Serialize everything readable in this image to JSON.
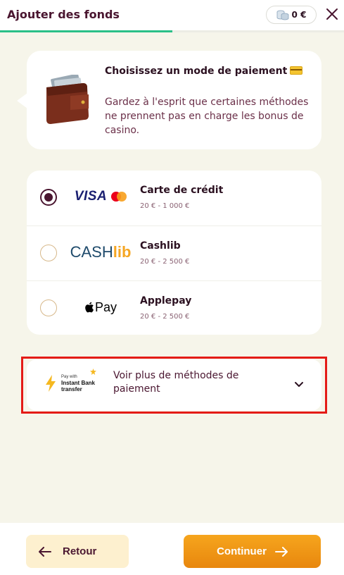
{
  "header": {
    "title": "Ajouter des fonds",
    "balance": "0 €",
    "progress_percent": 50
  },
  "info": {
    "title": "Choisissez un mode de paiement",
    "text": "Gardez à l'esprit que certaines méthodes ne prennent pas en charge les bonus de casino."
  },
  "methods": [
    {
      "name": "Carte de crédit",
      "range": "20 € - 1 000 €",
      "logo": "visa-mastercard-logo",
      "logo_text": "VISA",
      "selected": true
    },
    {
      "name": "Cashlib",
      "range": "20 € - 2 500 €",
      "logo": "cashlib-logo",
      "logo_text_a": "CASH",
      "logo_text_b": "lib",
      "selected": false
    },
    {
      "name": "Applepay",
      "range": "20 € - 2 500 €",
      "logo": "applepay-logo",
      "logo_text": "Pay",
      "selected": false
    }
  ],
  "more": {
    "label": "Voir plus de méthodes de paiement",
    "badge_small": "Pay with",
    "badge_strong": "Instant Bank transfer"
  },
  "footer": {
    "back_label": "Retour",
    "continue_label": "Continuer"
  },
  "colors": {
    "primary": "#4a1630",
    "accent": "#f29a18",
    "progress": "#2bbf88",
    "background": "#f6f5ea",
    "highlight": "#e41b17"
  }
}
